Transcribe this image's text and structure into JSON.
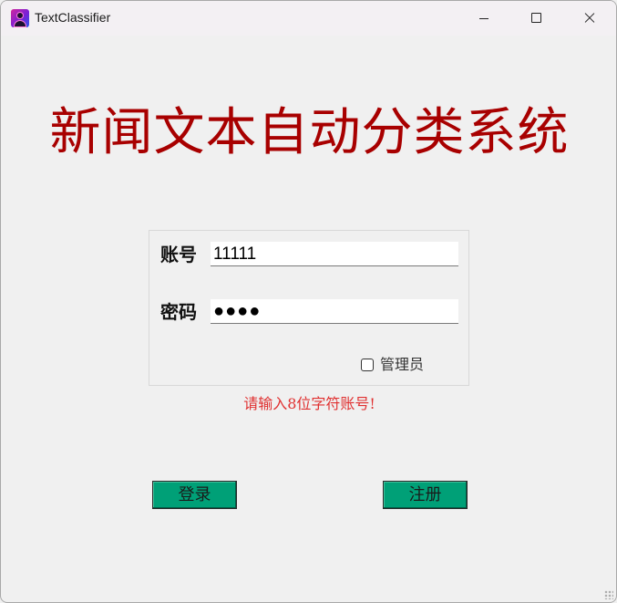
{
  "window": {
    "title": "TextClassifier",
    "icon": "app-person-icon"
  },
  "main": {
    "heading": "新闻文本自动分类系统",
    "heading_color": "#a80000"
  },
  "login": {
    "account_label": "账号",
    "account_value": "11111",
    "password_label": "密码",
    "password_value": "●●●●",
    "admin_checkbox_label": "管理员",
    "admin_checked": false
  },
  "hint": {
    "text": "请输入8位字符账号!",
    "color": "#e03030"
  },
  "buttons": {
    "login_label": "登录",
    "register_label": "注册",
    "button_color": "#00a077"
  }
}
